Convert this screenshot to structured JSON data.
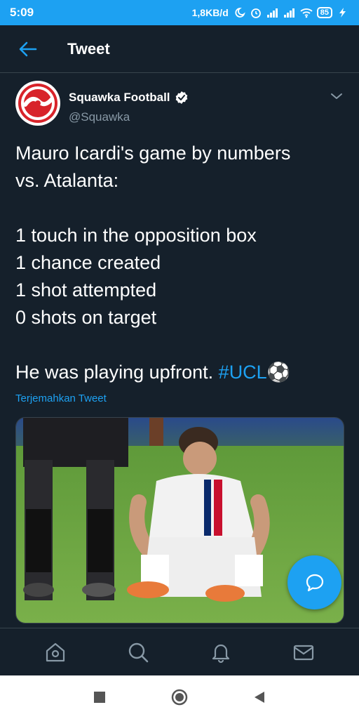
{
  "status_bar": {
    "time": "5:09",
    "network_speed": "1,8KB/d",
    "battery": "85"
  },
  "header": {
    "title": "Tweet",
    "back_icon": "arrow-left-icon"
  },
  "tweet": {
    "author_name": "Squawka Football",
    "author_handle": "@Squawka",
    "verified": true,
    "lines": [
      "Mauro Icardi's game by numbers",
      "vs. Atalanta:",
      "",
      "1 touch in the opposition box",
      "1 chance created",
      "1 shot attempted",
      "0 shots on target",
      "",
      "He was playing upfront. "
    ],
    "hashtag": "#UCL",
    "emoji": "⚽",
    "translate_label": "Terjemahkan Tweet"
  },
  "colors": {
    "background": "#15202b",
    "accent": "#1da1f2",
    "secondary_text": "#8899a6",
    "divider": "#38444d"
  },
  "bottom_nav": {
    "items": [
      "home-icon",
      "search-icon",
      "notifications-icon",
      "messages-icon"
    ]
  },
  "system_nav": {
    "items": [
      "recents-icon",
      "home-circle-icon",
      "back-triangle-icon"
    ]
  }
}
